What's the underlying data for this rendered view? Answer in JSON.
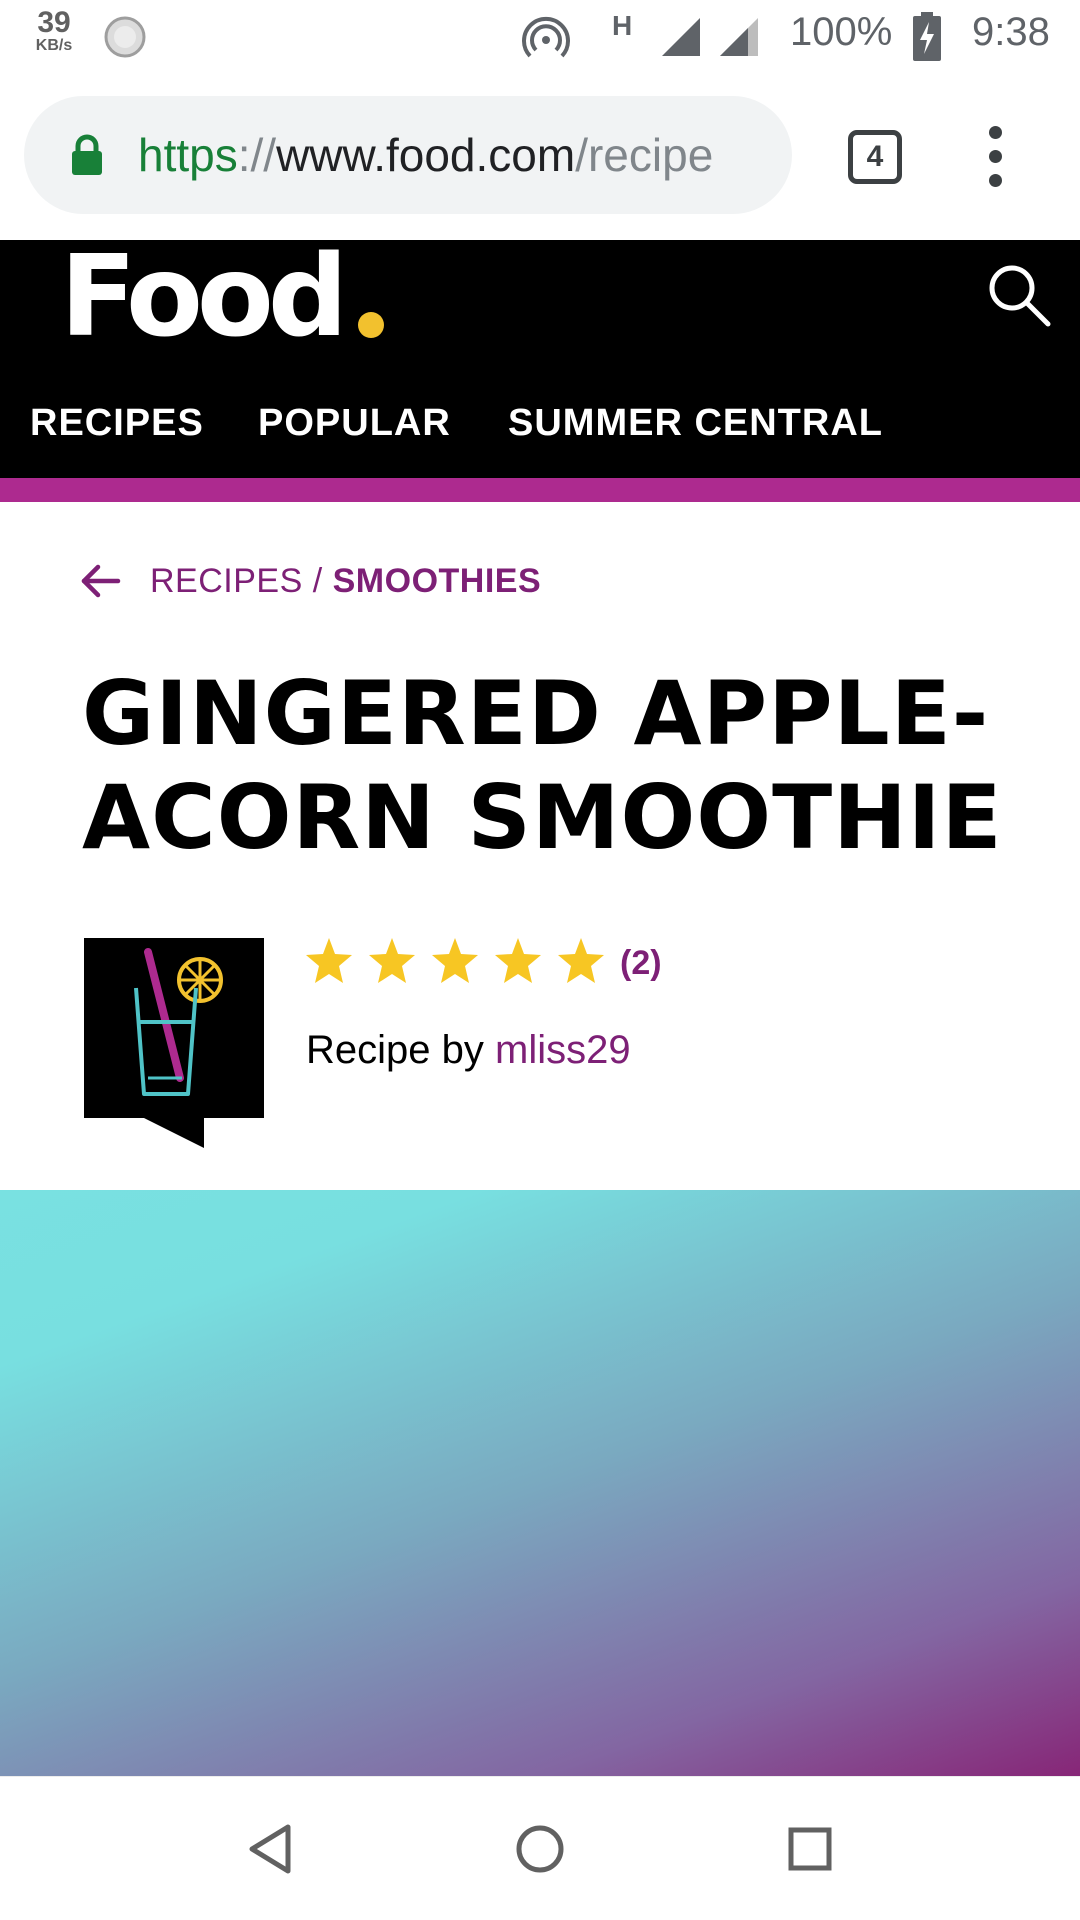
{
  "status_bar": {
    "speed_value": "39",
    "speed_unit": "KB/s",
    "network_type": "H",
    "battery": "100%",
    "time": "9:38",
    "icons": [
      "sync-icon",
      "hotspot-icon",
      "signal-icon",
      "signal-icon",
      "battery-charging-icon"
    ]
  },
  "browser": {
    "url_scheme": "https",
    "url_sep": "://",
    "url_host": "www.food.com",
    "url_path": "/recipe",
    "tab_count": "4",
    "icons": [
      "lock-icon",
      "more-vert-icon"
    ]
  },
  "site": {
    "logo": "Food",
    "logo_dot_color": "#f2c12e",
    "accent_color": "#ad2a8f",
    "link_color": "#7d2076",
    "nav": [
      "RECIPES",
      "POPULAR",
      "SUMMER CENTRAL"
    ],
    "icons": [
      "search-icon"
    ]
  },
  "breadcrumb": {
    "first": "RECIPES",
    "separator": "/",
    "second": "SMOOTHIES",
    "icon": "arrow-left-icon"
  },
  "recipe": {
    "title": "GINGERED APPLE-ACORN SMOOTHIE",
    "rating_stars": 5,
    "rating_count": "(2)",
    "recipe_by_label": "Recipe by",
    "author": "mliss29",
    "avatar_icon": "smoothie-glass-icon"
  },
  "system_nav": {
    "icons": [
      "back-icon",
      "home-icon",
      "recents-icon"
    ]
  }
}
